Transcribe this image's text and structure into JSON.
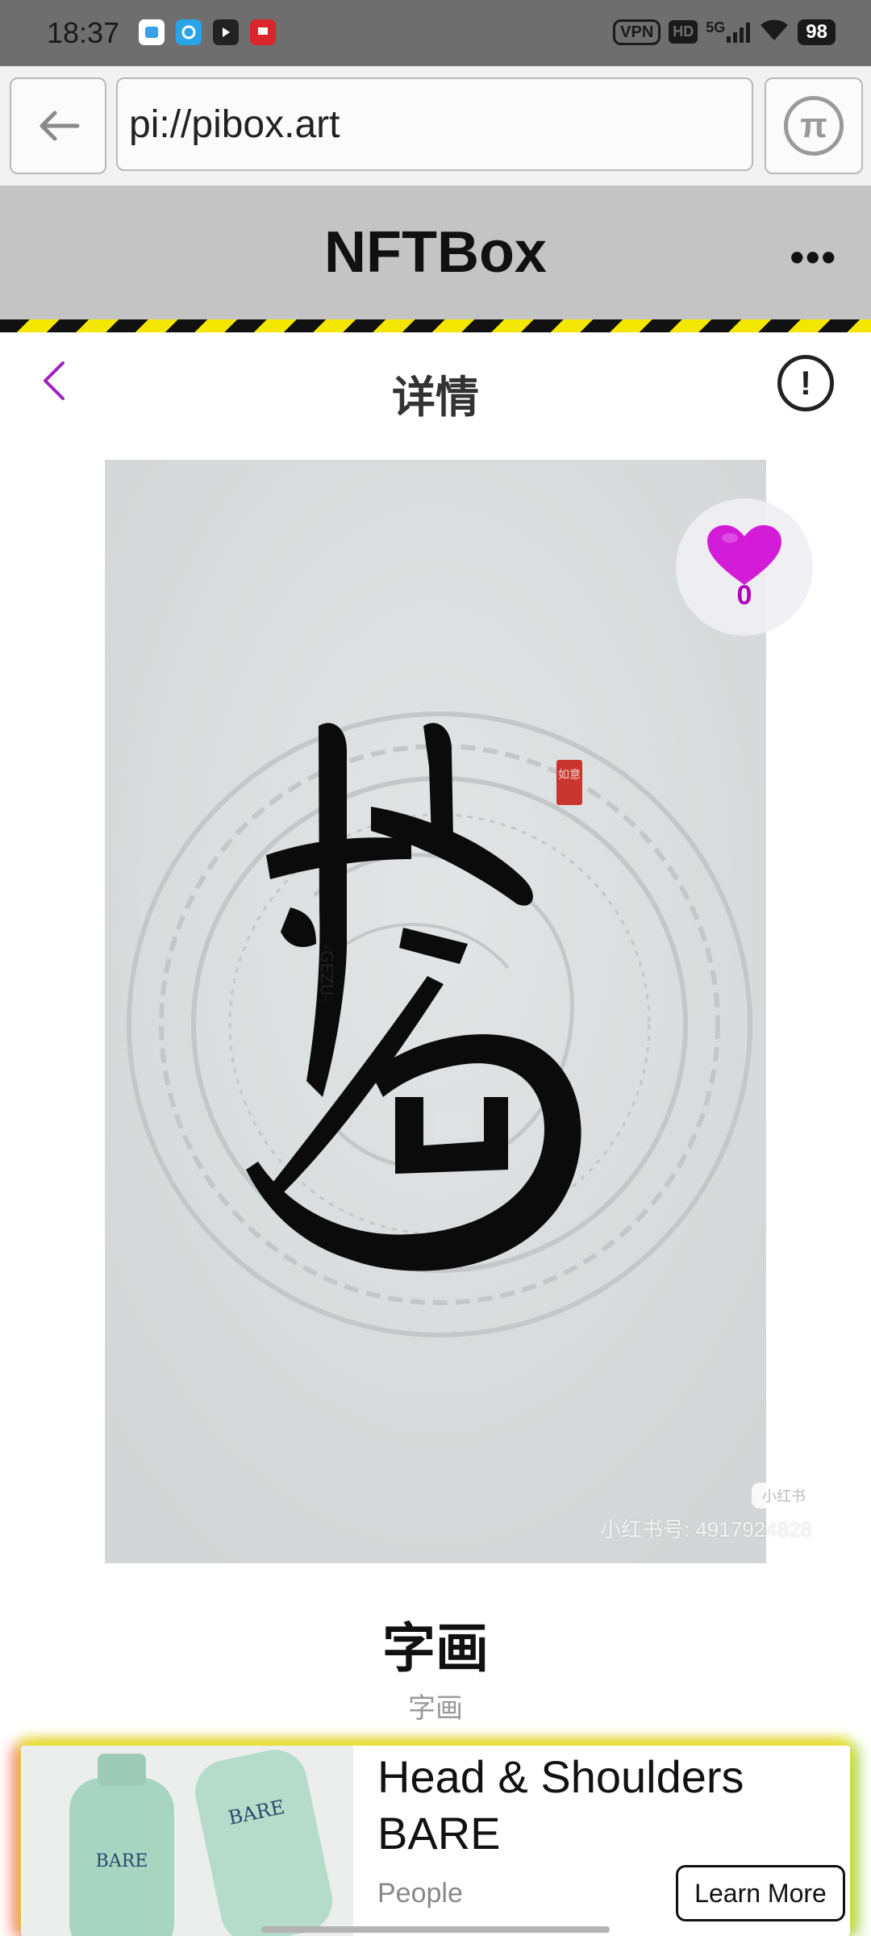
{
  "status_bar": {
    "time": "18:37",
    "app_icons": [
      "messages-app-icon",
      "browser-app-icon",
      "video-app-icon",
      "picc-app-icon"
    ],
    "vpn_label": "VPN",
    "hd_label": "HD",
    "network_label": "5G",
    "battery_level": "98"
  },
  "browser": {
    "url": "pi://pibox.art"
  },
  "app_header": {
    "title": "NFTBox"
  },
  "detail_header": {
    "title": "详情",
    "info_symbol": "!"
  },
  "artwork": {
    "like_count": "0",
    "watermark_box": "小红书",
    "watermark_text": "小红书号: 4917924828",
    "seal_text": "如意",
    "signature_text": "-GEZU-"
  },
  "item": {
    "title": "字画",
    "subtitle": "字画"
  },
  "ad": {
    "title": "Head & Shoulders BARE",
    "brand": "People",
    "cta_label": "Learn More"
  },
  "colors": {
    "status_bar_bg": "#6e6e6e",
    "header_bg": "#c4c4c4",
    "hazard_yellow": "#f3e600",
    "accent_purple": "#b000b8",
    "heart_magenta": "#d21cd8"
  }
}
